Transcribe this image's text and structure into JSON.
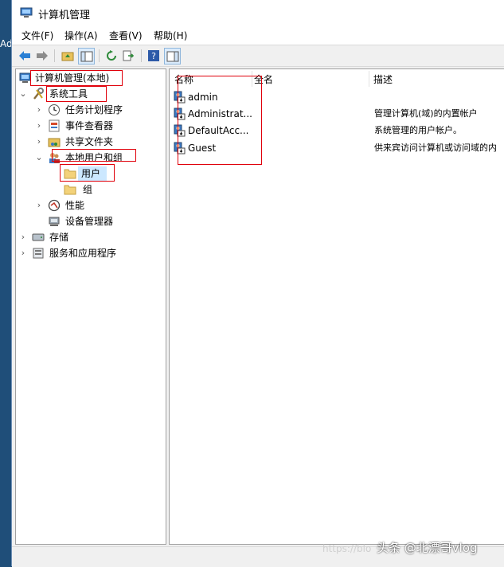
{
  "desktop": {
    "left_text": "Ad"
  },
  "window": {
    "title": "计算机管理"
  },
  "menu": [
    "文件(F)",
    "操作(A)",
    "查看(V)",
    "帮助(H)"
  ],
  "toolbar": {
    "icons": [
      "back-arrow-icon",
      "forward-arrow-icon",
      "up-folder-icon",
      "show-tree-icon",
      "refresh-icon",
      "export-icon",
      "help-icon",
      "show-action-pane-icon"
    ]
  },
  "tree": {
    "root": "计算机管理(本地)",
    "system_tools": "系统工具",
    "task_scheduler": "任务计划程序",
    "event_viewer": "事件查看器",
    "shared_folders": "共享文件夹",
    "local_users_groups": "本地用户和组",
    "users": "用户",
    "groups": "组",
    "performance": "性能",
    "device_manager": "设备管理器",
    "storage": "存储",
    "services_apps": "服务和应用程序"
  },
  "list": {
    "columns": [
      "名称",
      "全名",
      "描述"
    ],
    "rows": [
      {
        "name": "admin",
        "full_name": "",
        "description": ""
      },
      {
        "name": "Administrat...",
        "full_name": "",
        "description": "管理计算机(域)的内置帐户"
      },
      {
        "name": "DefaultAcc...",
        "full_name": "",
        "description": "系统管理的用户帐户。"
      },
      {
        "name": "Guest",
        "full_name": "",
        "description": "供来宾访问计算机或访问域的内"
      }
    ]
  },
  "watermarks": {
    "url": "https://blo",
    "author": "头条 @北漂哥vlog"
  },
  "colors": {
    "highlight_box": "#e0000a",
    "selection": "#cce8ff",
    "desktop": "#1f4e79"
  }
}
